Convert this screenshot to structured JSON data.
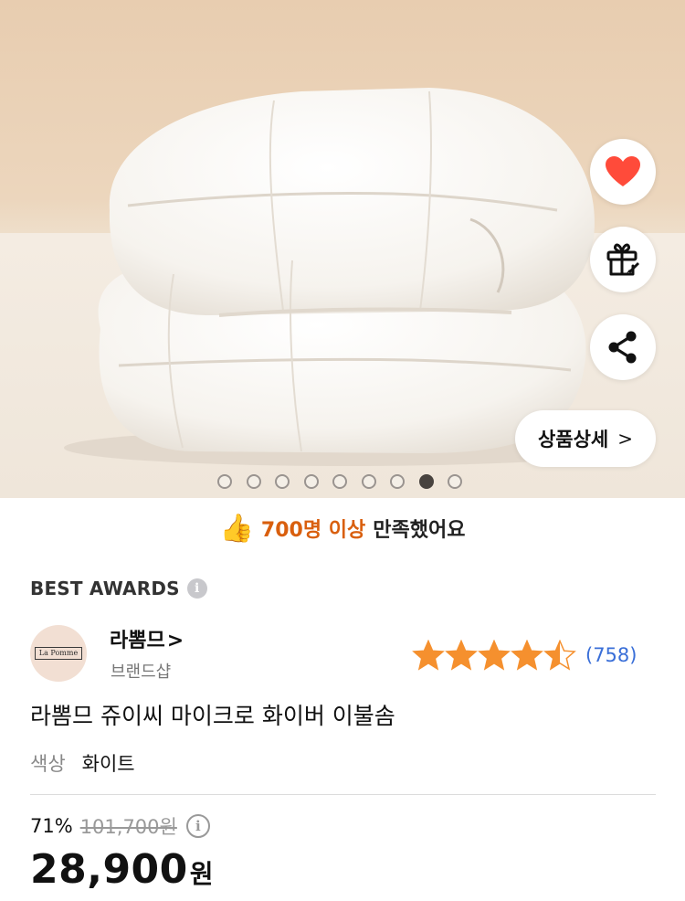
{
  "hero": {
    "detail_button_label": "상품상세",
    "detail_button_chevron": ">",
    "image_subject": "folded white microfiber comforter",
    "carousel": {
      "total": 9,
      "active_index": 7
    },
    "icons": [
      "heart-icon",
      "gift-icon",
      "share-icon"
    ],
    "colors": {
      "heart": "#ff4b3a",
      "dot_active": "#48433f"
    }
  },
  "satisfaction": {
    "emoji": "👍",
    "highlight": "700명 이상",
    "rest": "만족했어요",
    "highlight_color": "#d95f0e"
  },
  "awards": {
    "label": "BEST AWARDS",
    "info": "i"
  },
  "brand": {
    "logo_text": "La Pomme",
    "name": "라뽐므",
    "chevron": ">",
    "subtitle": "브랜드샵",
    "rating_stars": 4.5,
    "rating_count": "(758)",
    "star_color": "#f5902e"
  },
  "product": {
    "title": "라뽐므 쥬이씨 마이크로 화이버 이불솜"
  },
  "option": {
    "label": "색상",
    "value": "화이트"
  },
  "price": {
    "discount": "71%",
    "original": "101,700원",
    "info": "i",
    "current_number": "28,900",
    "currency": "원"
  }
}
